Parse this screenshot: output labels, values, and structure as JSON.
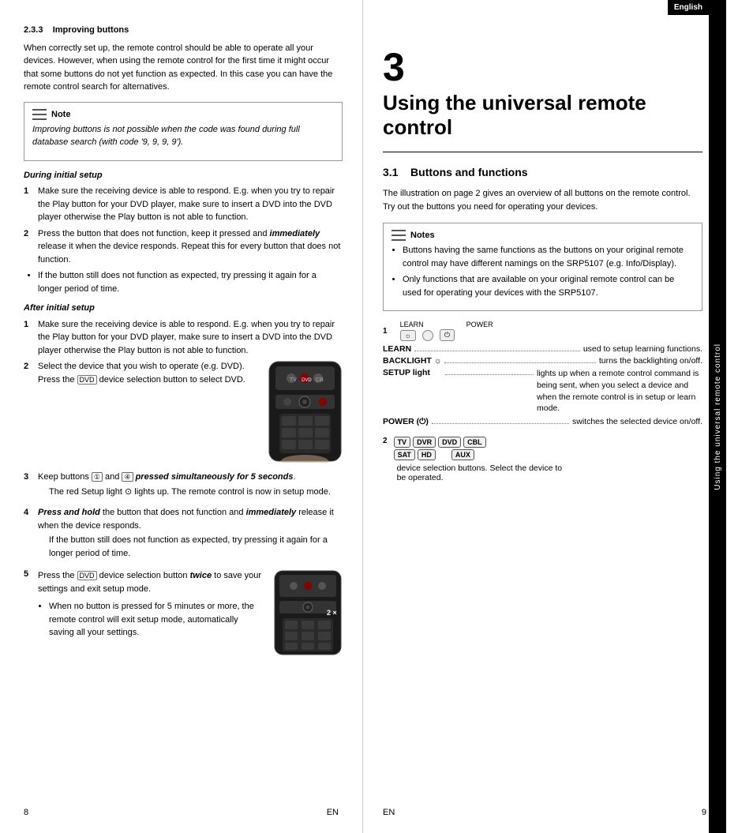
{
  "left_page": {
    "page_number": "8",
    "page_lang": "EN",
    "section": {
      "number": "2.3.3",
      "title": "Improving buttons",
      "intro": "When correctly set up, the remote control should be able to operate all your devices. However, when using the remote control for the first time it might occur that some buttons do not yet function as expected. In this case you can have the remote control search for alternatives."
    },
    "note_box": {
      "label": "Note",
      "text": "Improving buttons is not possible when the code was found during full database search (with code '9, 9, 9, 9')."
    },
    "during_initial_setup": {
      "title": "During initial setup",
      "steps": [
        {
          "num": "1",
          "text": "Make sure the receiving device is able to respond. E.g. when you try to repair the Play button for your DVD player, make sure to insert a DVD into the DVD player otherwise the Play button is not able to function."
        },
        {
          "num": "2",
          "text": "Press the button that does not function, keep it pressed and immediately release it when the device responds. Repeat this for every button that does not function."
        },
        {
          "bullet": "If the button still does not function as expected, try pressing it again for a longer period of time."
        }
      ]
    },
    "after_initial_setup": {
      "title": "After initial setup",
      "steps": [
        {
          "num": "1",
          "text": "Make sure the receiving device is able to respond. E.g. when you try to repair the Play button for your DVD player, make sure to insert a DVD into the DVD player otherwise the Play button is not able to function."
        },
        {
          "num": "2",
          "text": "Select the device that you wish to operate (e.g. DVD).",
          "sub": "Press the DVD device selection button to select DVD."
        },
        {
          "num": "3",
          "text": "Keep buttons (1) and (4) pressed simultaneously for 5 seconds.",
          "bullet": "The red Setup light ⊙ lights up. The remote control is now in setup mode."
        },
        {
          "num": "4",
          "text": "Press and hold the button that does not function and immediately release it when the device responds.",
          "bullet": "If the button still does not function as expected, try pressing it again for a longer period of time."
        }
      ]
    },
    "step5": {
      "num": "5",
      "text_a": "Press the DVD device selection button twice to save your settings and exit setup mode.",
      "bullet": "When no button is pressed for 5 minutes or more, the remote control will exit setup mode, automatically saving all your settings."
    }
  },
  "right_page": {
    "page_number": "9",
    "page_lang": "EN",
    "chapter": {
      "number": "3",
      "title": "Using the universal remote control"
    },
    "section_3_1": {
      "number": "3.1",
      "title": "Buttons and functions",
      "intro": "The illustration on page 2 gives an overview of all buttons on the remote control. Try out the buttons you need for operating your devices."
    },
    "notes_box": {
      "label": "Notes",
      "items": [
        "Buttons having the same functions as the buttons on your original remote control may have different namings on the SRP5107 (e.g. Info/Display).",
        "Only functions that are available on your original remote control can be used for operating your devices with the SRP5107."
      ]
    },
    "functions": {
      "item1_label_learn": "LEARN",
      "item1_label_backlight": "BACKLIGHT",
      "item1_label_setup": "SETUP light",
      "item1_label_power": "POWER",
      "item1_desc_learn": "used to setup learning functions.",
      "item1_desc_backlight": "turns the backlighting on/off.",
      "item1_desc_setup": "lights up when a remote control command is being sent, when you select a device and when the remote control is in setup or learn mode.",
      "item1_desc_power": "switches the selected device on/off.",
      "item2_label": "TV DVR DVD CBL SAT HD AUX",
      "item2_desc": "device selection buttons. Select the device to be operated."
    },
    "side_tab": "Using the universal remote control",
    "english_tab": "English"
  }
}
